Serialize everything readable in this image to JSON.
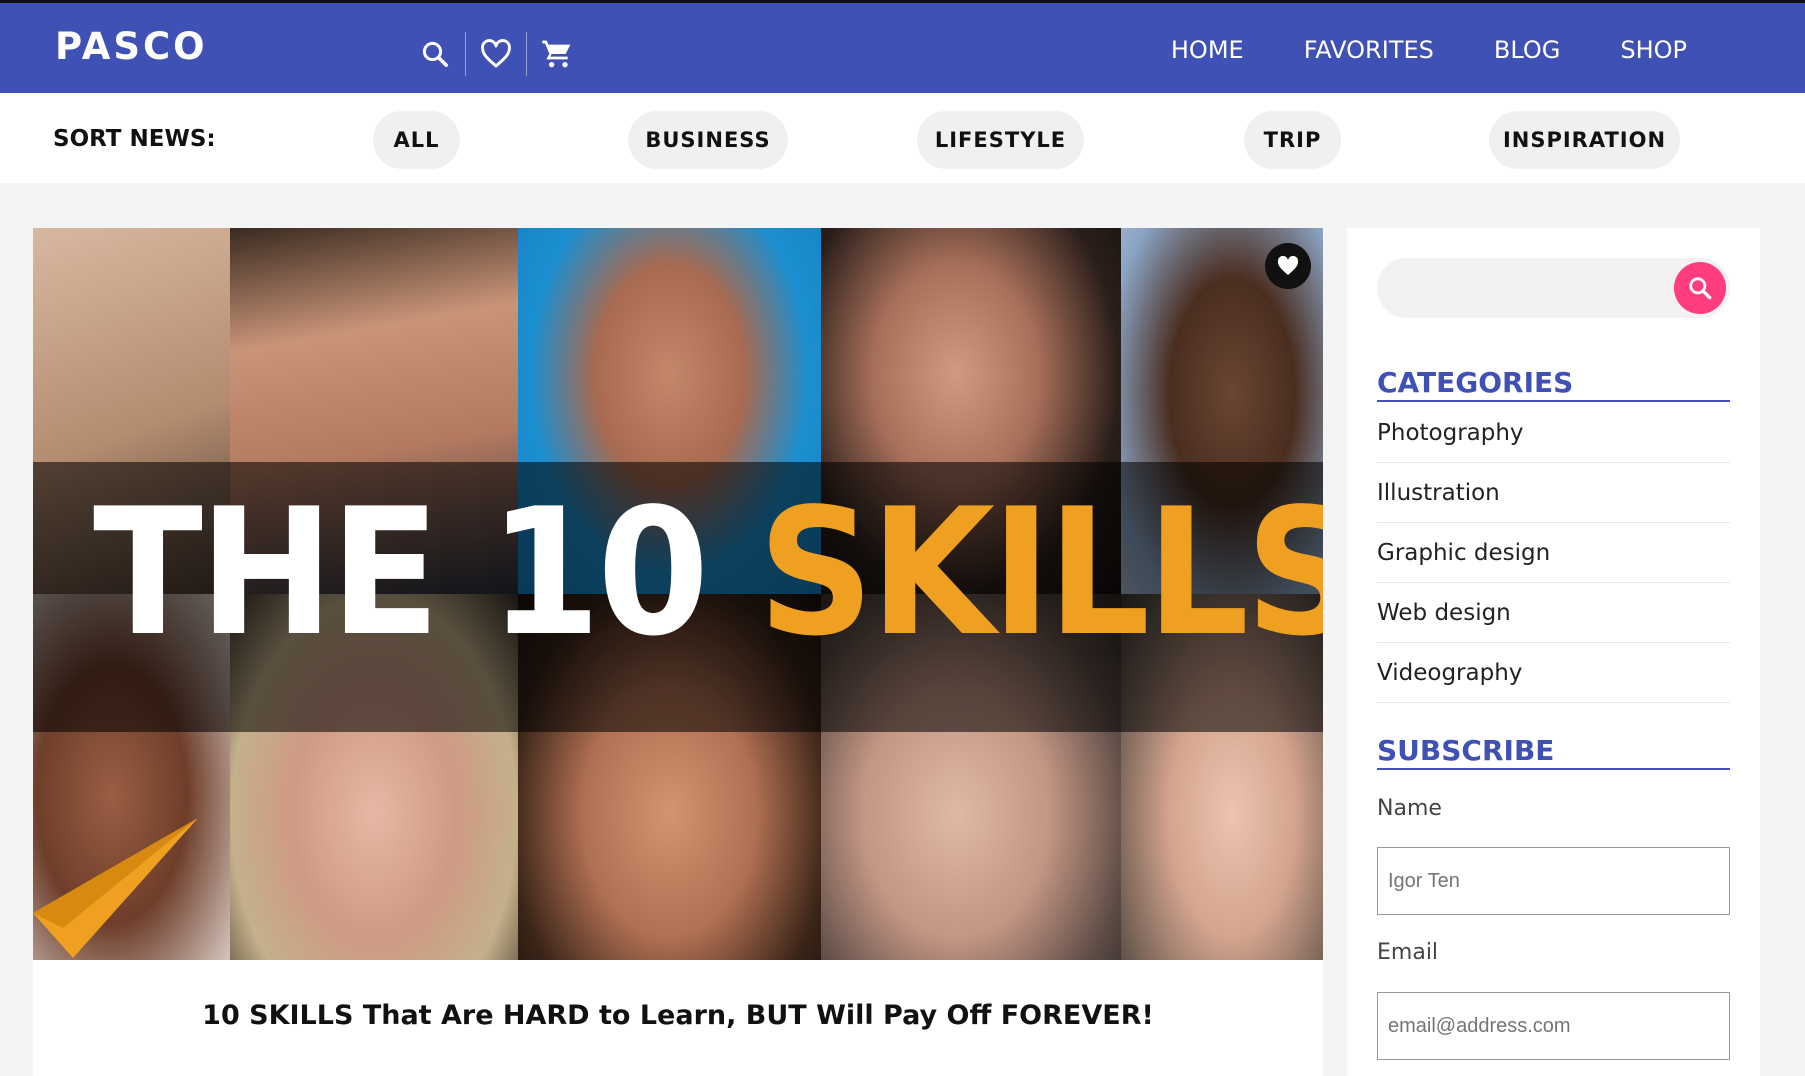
{
  "header": {
    "logo": "PASCO",
    "nav": [
      "HOME",
      "FAVORITES",
      "BLOG",
      "SHOP"
    ],
    "icons": [
      "search-icon",
      "heart-icon",
      "cart-icon"
    ],
    "brand_color": "#3f51b5"
  },
  "sort": {
    "label": "SORT NEWS:",
    "options": [
      "ALL",
      "BUSINESS",
      "LIFESTYLE",
      "TRIP",
      "INSPIRATION"
    ]
  },
  "hero": {
    "headline_white": "THE 10 ",
    "headline_orange": "SKILLS",
    "accent_color": "#f0a020",
    "caption": "10 SKILLS That Are HARD to Learn, BUT Will Pay Off FOREVER!"
  },
  "sidebar": {
    "search_placeholder": "",
    "categories_title": "CATEGORIES",
    "categories": [
      "Photography",
      "Illustration",
      "Graphic design",
      "Web design",
      "Videography"
    ],
    "subscribe_title": "SUBSCRIBE",
    "name_label": "Name",
    "name_placeholder": "Igor Ten",
    "email_label": "Email",
    "email_placeholder": "email@address.com",
    "search_button_color": "#ff3d7f"
  }
}
